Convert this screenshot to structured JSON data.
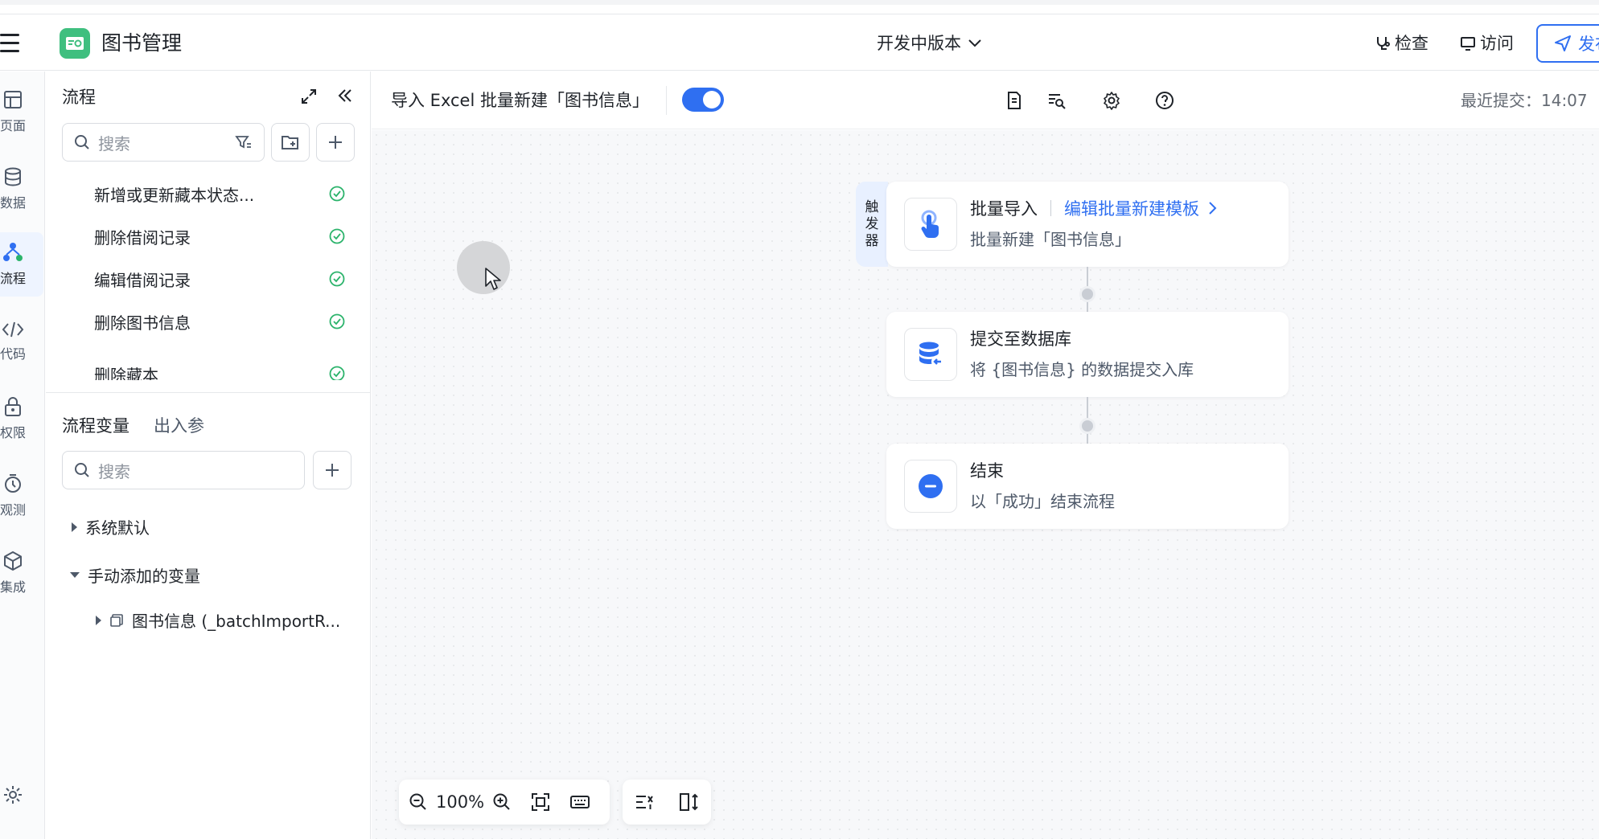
{
  "app": {
    "title": "图书管理",
    "version_label": "开发中版本"
  },
  "header": {
    "check_label": "检查",
    "visit_label": "访问",
    "publish_label": "发布"
  },
  "rail": {
    "items": [
      {
        "label": "页面",
        "icon": "layout-icon"
      },
      {
        "label": "数据",
        "icon": "database-icon"
      },
      {
        "label": "流程",
        "icon": "flow-icon",
        "active": true
      },
      {
        "label": "代码",
        "icon": "code-icon"
      },
      {
        "label": "权限",
        "icon": "lock-icon"
      },
      {
        "label": "观测",
        "icon": "clock-icon"
      },
      {
        "label": "集成",
        "icon": "cube-icon"
      }
    ]
  },
  "flow_panel": {
    "title": "流程",
    "search_placeholder": "搜索",
    "items": [
      {
        "name": "新增或更新藏本状态...",
        "status": "ok"
      },
      {
        "name": "删除借阅记录",
        "status": "ok"
      },
      {
        "name": "编辑借阅记录",
        "status": "ok"
      },
      {
        "name": "删除图书信息",
        "status": "ok"
      },
      {
        "name": "删除藏本",
        "status": "ok"
      }
    ],
    "tabs": {
      "variables": "流程变量",
      "io": "出入参"
    },
    "var_search_placeholder": "搜索",
    "tree": {
      "system": "系统默认",
      "manual": "手动添加的变量",
      "var1": "图书信息 (_batchImportR..."
    }
  },
  "toolbar": {
    "flow_name": "导入 Excel 批量新建「图书信息」",
    "toggle_on": true,
    "last_submit": "最近提交：14:07"
  },
  "canvas": {
    "trigger_tag": [
      "触",
      "发",
      "器"
    ],
    "nodes": [
      {
        "title": "批量导入",
        "link": "编辑批量新建模板",
        "subtitle": "批量新建「图书信息」",
        "icon": "touch-icon"
      },
      {
        "title": "提交至数据库",
        "subtitle": "将 {图书信息} 的数据提交入库",
        "icon": "database-submit-icon"
      },
      {
        "title": "结束",
        "subtitle": "以「成功」结束流程",
        "icon": "end-icon"
      }
    ],
    "zoom": "100%"
  },
  "colors": {
    "accent": "#2f6ff1",
    "success": "#2bb36b",
    "brand_green": "#3fbf7f"
  }
}
